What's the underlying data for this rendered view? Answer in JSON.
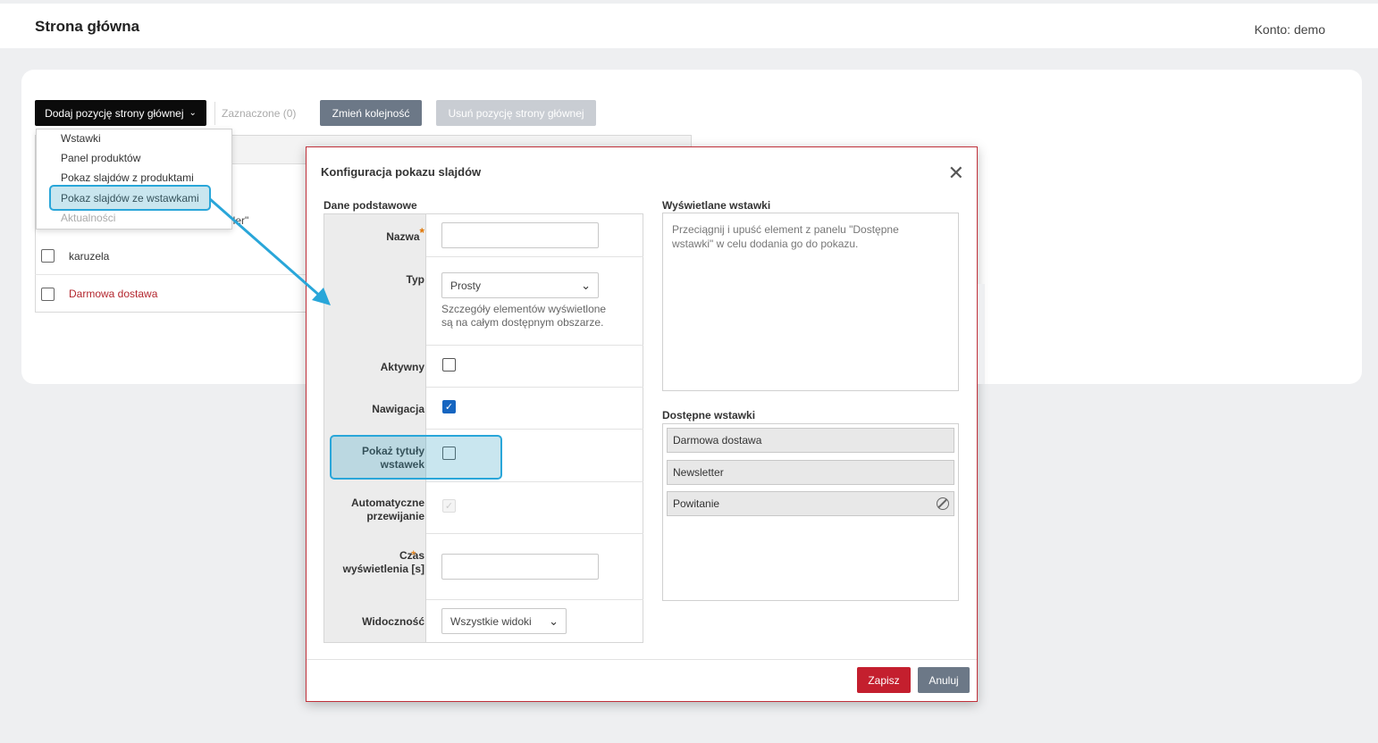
{
  "header": {
    "title": "Strona główna",
    "account_label": "Konto:",
    "account_user": "demo"
  },
  "toolbar": {
    "add_label": "Dodaj pozycję strony głównej",
    "selected_label": "Zaznaczone (0)",
    "order_label": "Zmień kolejność",
    "remove_label": "Usuń pozycję strony głównej"
  },
  "dropdown": {
    "items": [
      "Wstawki",
      "Panel produktów",
      "Pokaz slajdów z produktami",
      "Pokaz slajdów ze wstawkami",
      "Aktualności"
    ]
  },
  "list": {
    "partial_text": "ller\"",
    "rows": [
      {
        "label": "karuzela",
        "color": "#333333"
      },
      {
        "label": "Darmowa dostawa",
        "color": "#b3262e"
      }
    ]
  },
  "modal": {
    "title": "Konfiguracja pokazu slajdów",
    "basic_section": "Dane podstawowe",
    "displayed_section": "Wyświetlane wstawki",
    "available_section": "Dostępne wstawki",
    "fields": {
      "name_label": "Nazwa",
      "name_value": "",
      "type_label": "Typ",
      "type_value": "Prosty",
      "type_hint": "Szczegóły elementów wyświetlone są na całym dostępnym obszarze.",
      "active_label": "Aktywny",
      "active_checked": false,
      "navigation_label": "Nawigacja",
      "navigation_checked": true,
      "show_titles_label": "Pokaż tytuły wstawek",
      "show_titles_checked": false,
      "autoscroll_label": "Automatyczne przewijanie",
      "autoscroll_checked": true,
      "duration_label": "Czas wyświetlenia [s]",
      "duration_value": "",
      "visibility_label": "Widoczność",
      "visibility_value": "Wszystkie widoki"
    },
    "drop_hint": "Przeciągnij i upuść element z panelu \"Dostępne wstawki\" w celu dodania go do pokazu.",
    "available_items": [
      "Darmowa dostawa",
      "Newsletter",
      "Powitanie"
    ],
    "save_label": "Zapisz",
    "cancel_label": "Anuluj"
  },
  "colors": {
    "accent": "#c41f2e",
    "highlight": "#29a6d9",
    "checkbox_checked": "#1565c0"
  }
}
